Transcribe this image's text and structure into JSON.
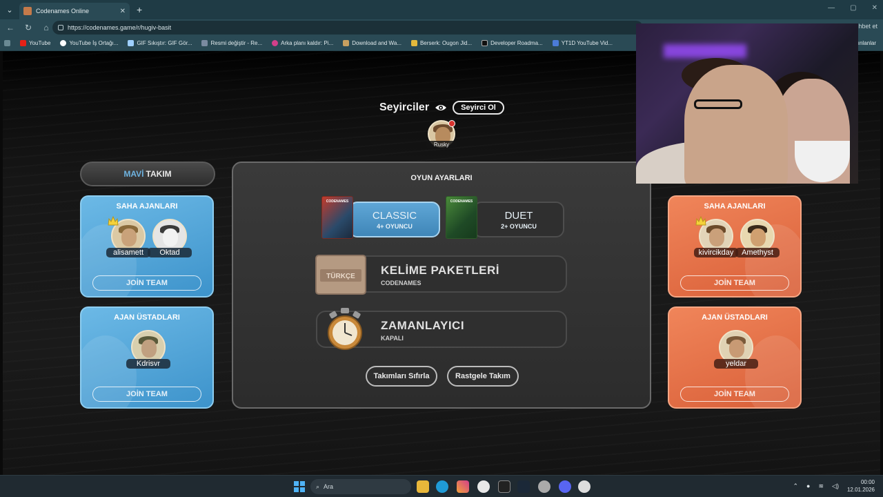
{
  "browser": {
    "tab_title": "Codenames Online",
    "new_tab": "+",
    "url": "https://codenames.game/r/hugiv-basit",
    "right_text": "hbet et",
    "bookmarks": [
      "YouTube",
      "YouTube İş Ortağı...",
      "GIF Sıkıştır: GIF Gör...",
      "Resmi değiştir - Re...",
      "Arka planı kaldır: Pi...",
      "Download and Wa...",
      "Berserk: Ougon Jid...",
      "Developer Roadma...",
      "YT1D YouTube Vid..."
    ],
    "bookmarks_more": "ınlanlar"
  },
  "spectators": {
    "title": "Seyirciler",
    "button": "Seyirci Ol",
    "user": "Rusky"
  },
  "blue_team": {
    "header_accent": "MAVİ",
    "header_rest": "TAKIM",
    "operatives_title": "SAHA AJANLARI",
    "operatives": [
      "alisamett",
      "Oktad"
    ],
    "spymasters_title": "AJAN ÜSTADLARI",
    "spymasters": [
      "Kdrisvr"
    ],
    "join_label": "JOİN TEAM"
  },
  "red_team": {
    "operatives_title": "SAHA AJANLARI",
    "operatives": [
      "kivircikday",
      "Amethyst"
    ],
    "spymasters_title": "AJAN ÜSTADLARI",
    "spymasters": [
      "yeldar"
    ],
    "join_label": "JOİN TEAM"
  },
  "settings": {
    "title": "OYUN AYARLARI",
    "classic": {
      "name": "CLASSIC",
      "sub": "4+ OYUNCU",
      "box": "CODENAMES"
    },
    "duet": {
      "name": "DUET",
      "sub": "2+ OYUNCU",
      "box": "CODENAMES"
    },
    "word_packs": {
      "title": "KELİME PAKETLERİ",
      "sub": "CODENAMES",
      "badge": "TÜRKÇE"
    },
    "timer": {
      "title": "ZAMANLAYICI",
      "sub": "KAPALI"
    },
    "reset_teams": "Takımları Sıfırla",
    "random_teams": "Rastgele Takım"
  },
  "taskbar": {
    "search_placeholder": "Ara",
    "time": "00:00",
    "date": "12.01.2026"
  }
}
